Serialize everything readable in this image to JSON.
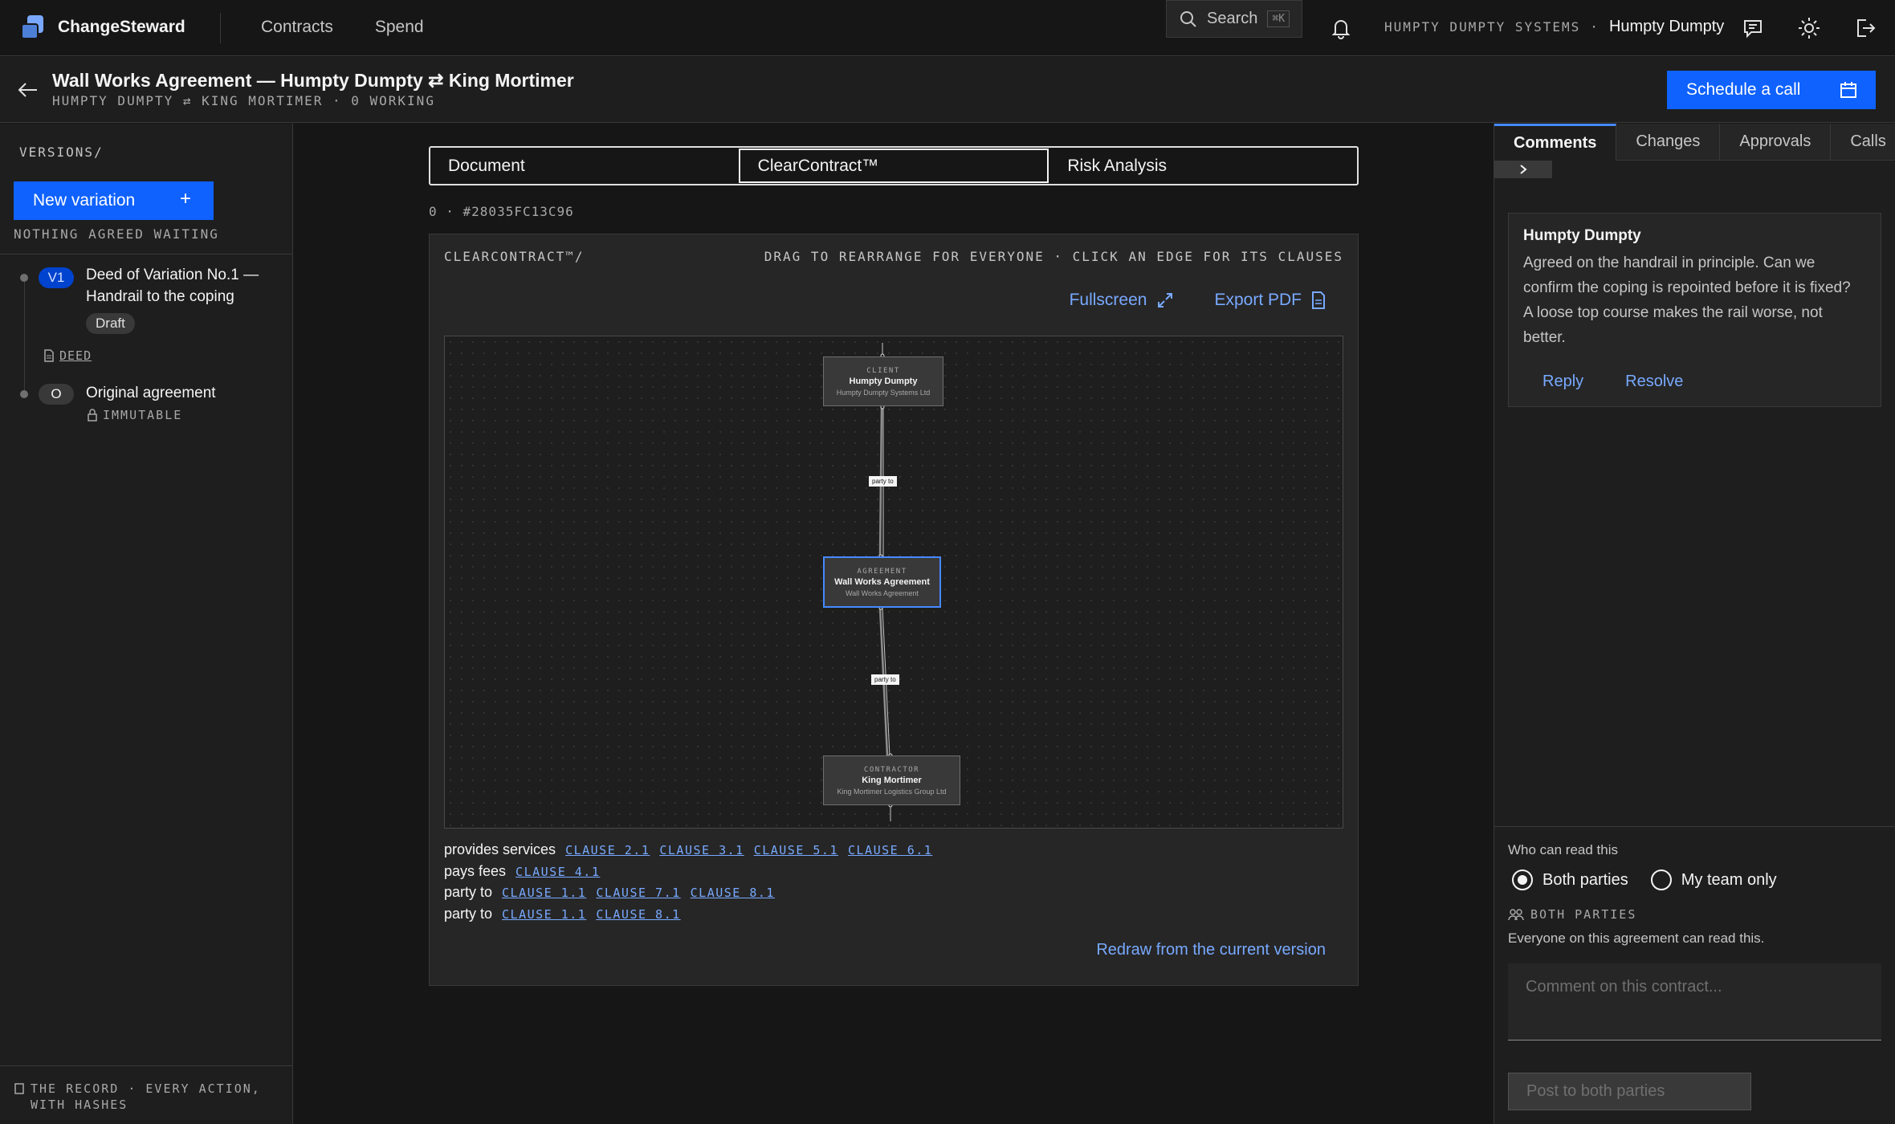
{
  "brand": {
    "name": "ChangeSteward"
  },
  "nav": {
    "contracts": "Contracts",
    "spend": "Spend"
  },
  "search": {
    "label": "Search",
    "shortcut": "⌘K"
  },
  "org": {
    "name": "HUMPTY DUMPTY SYSTEMS",
    "sep": "·",
    "user": "Humpty Dumpty"
  },
  "header": {
    "title": "Wall Works Agreement — Humpty Dumpty ⇄ King Mortimer",
    "subtitle": "HUMPTY DUMPTY ⇄ KING MORTIMER · 0 WORKING",
    "schedule_label": "Schedule a call"
  },
  "versions": {
    "label": "VERSIONS/",
    "new_label": "New variation",
    "status": "NOTHING AGREED WAITING",
    "items": [
      {
        "badge": "V1",
        "title": "Deed of Variation No.1 — Handrail to the coping",
        "state": "Draft",
        "doc": "DEED"
      },
      {
        "badge": "O",
        "title": "Original agreement",
        "note": "IMMUTABLE"
      }
    ],
    "record": "THE RECORD · EVERY ACTION, WITH HASHES"
  },
  "tabs": [
    "Document",
    "ClearContract™",
    "Risk Analysis"
  ],
  "hash": "0 · #28035FC13C96",
  "clearcontract": {
    "label": "CLEARCONTRACT™/",
    "hint": "DRAG TO REARRANGE FOR EVERYONE · CLICK AN EDGE FOR ITS CLAUSES",
    "fullscreen": "Fullscreen",
    "export": "Export PDF",
    "nodes": {
      "client": {
        "kind": "CLIENT",
        "name": "Humpty Dumpty",
        "sub": "Humpty Dumpty Systems Ltd"
      },
      "agreement": {
        "kind": "AGREEMENT",
        "name": "Wall Works Agreement",
        "sub": "Wall Works Agreement"
      },
      "contractor": {
        "kind": "CONTRACTOR",
        "name": "King Mortimer",
        "sub": "King Mortimer Logistics Group Ltd"
      }
    },
    "edges": [
      "party to",
      "party to"
    ],
    "clauses": [
      {
        "label": "provides services",
        "refs": [
          "CLAUSE 2.1",
          "CLAUSE 3.1",
          "CLAUSE 5.1",
          "CLAUSE 6.1"
        ]
      },
      {
        "label": "pays fees",
        "refs": [
          "CLAUSE 4.1"
        ]
      },
      {
        "label": "party to",
        "refs": [
          "CLAUSE 1.1",
          "CLAUSE 7.1",
          "CLAUSE 8.1"
        ]
      },
      {
        "label": "party to",
        "refs": [
          "CLAUSE 1.1",
          "CLAUSE 8.1"
        ]
      }
    ],
    "redraw": "Redraw from the current version"
  },
  "right": {
    "tabs": [
      "Comments",
      "Changes",
      "Approvals",
      "Calls"
    ],
    "comment": {
      "author": "Humpty Dumpty",
      "text": "Agreed on the handrail in principle. Can we confirm the coping is repointed before it is fixed? A loose top course makes the rail worse, not better.",
      "reply": "Reply",
      "resolve": "Resolve"
    },
    "who_label": "Who can read this",
    "options": [
      "Both parties",
      "My team only"
    ],
    "selected_option": "Both parties",
    "visibility_tag": "BOTH PARTIES",
    "visibility_desc": "Everyone on this agreement can read this.",
    "placeholder": "Comment on this contract...",
    "post_label": "Post to both parties"
  }
}
